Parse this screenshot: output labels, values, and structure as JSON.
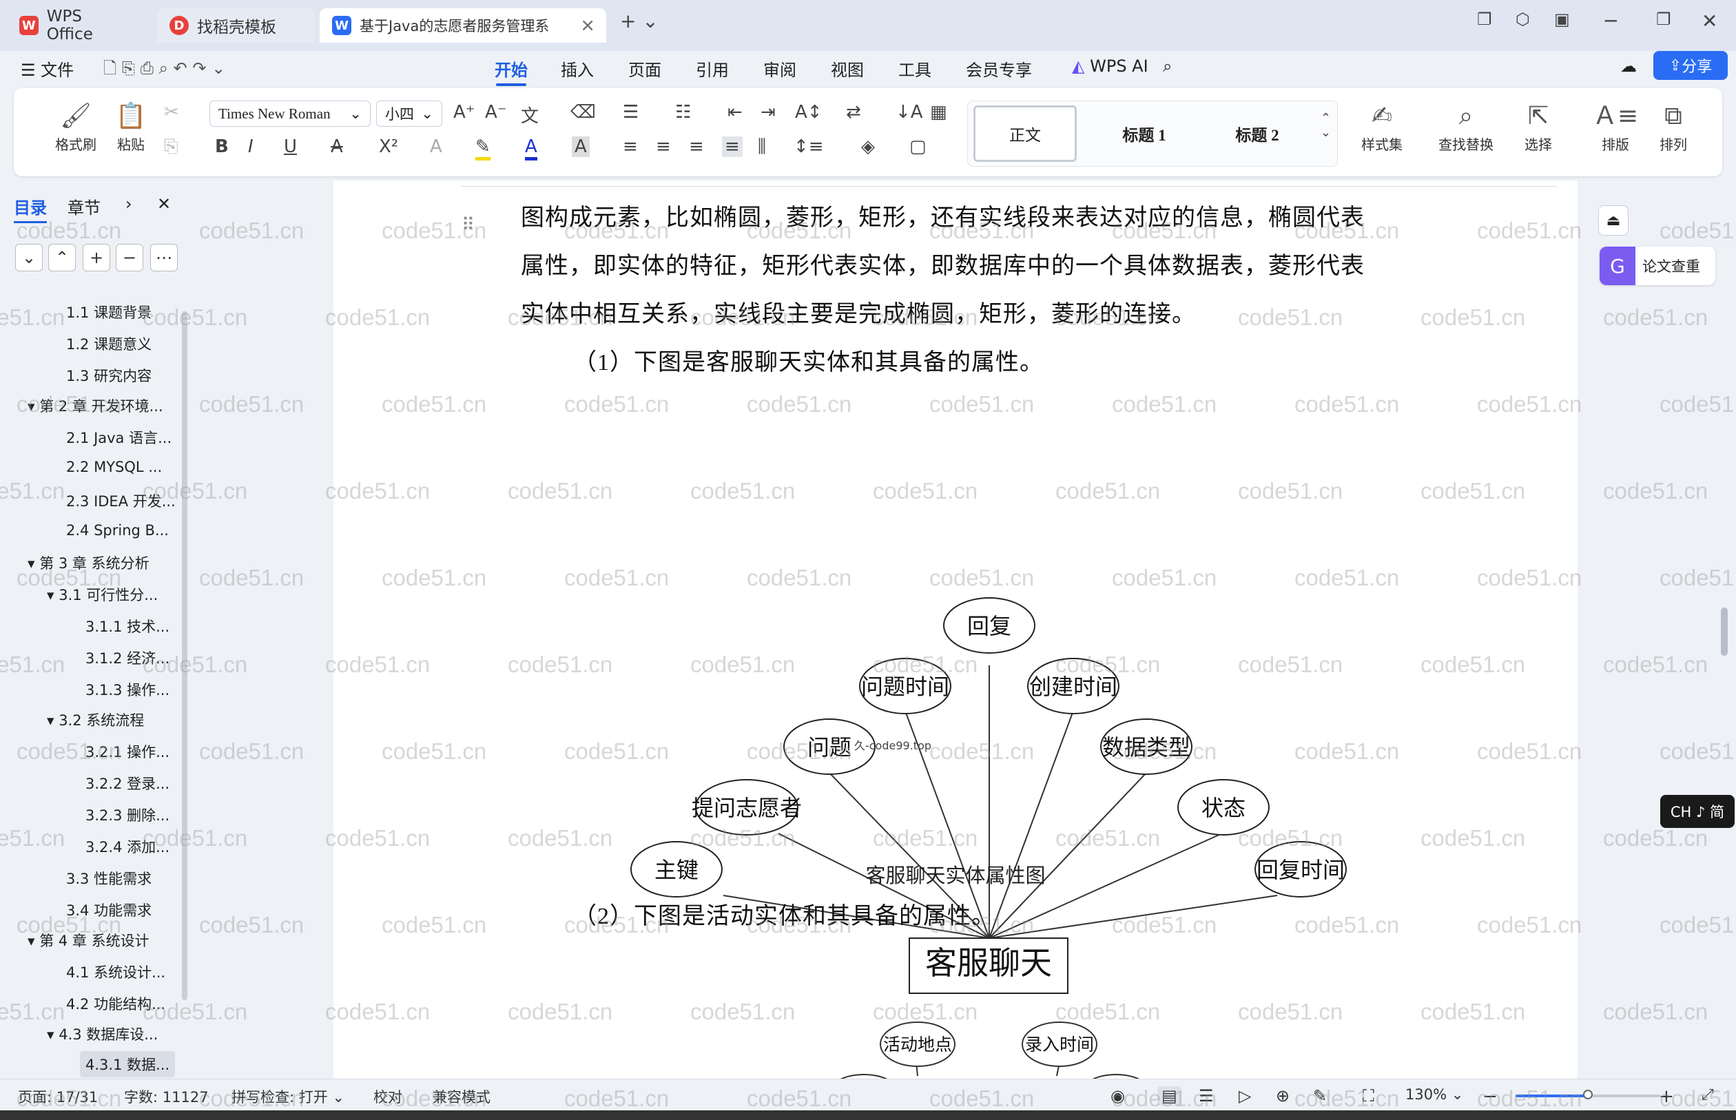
{
  "tabs": [
    {
      "label": "WPS Office"
    },
    {
      "label": "找稻壳模板"
    },
    {
      "label": "基于Java的志愿者服务管理系"
    }
  ],
  "menu": {
    "file": "文件",
    "items": [
      "开始",
      "插入",
      "页面",
      "引用",
      "审阅",
      "视图",
      "工具",
      "会员专享"
    ],
    "ai": "WPS AI",
    "share": "分享"
  },
  "ribbon": {
    "format_painter": "格式刷",
    "paste": "粘贴",
    "font": "Times New Roman",
    "size": "小四",
    "style_normal": "正文",
    "style_h1": "标题 1",
    "style_h2": "标题 2",
    "styleset": "样式集",
    "find": "查找替换",
    "select": "选择",
    "typeset": "排版",
    "arrange": "排列"
  },
  "sidebar": {
    "tab_toc": "目录",
    "tab_chapter": "章节",
    "items": [
      "1.1 课题背景",
      "1.2 课题意义",
      "1.3 研究内容",
      "第 2 章 开发环境...",
      "2.1 Java 语言...",
      "2.2 MYSQL ...",
      "2.3 IDEA 开发...",
      "2.4 Spring B...",
      "第 3 章 系统分析",
      "3.1 可行性分...",
      "3.1.1 技术...",
      "3.1.2 经济...",
      "3.1.3 操作...",
      "3.2 系统流程",
      "3.2.1 操作...",
      "3.2.2 登录...",
      "3.2.3 删除...",
      "3.2.4 添加...",
      "3.3 性能需求",
      "3.4 功能需求",
      "第 4 章 系统设计",
      "4.1 系统设计...",
      "4.2 功能结构...",
      "4.3 数据库设...",
      "4.3.1 数据..."
    ]
  },
  "doc": {
    "p1": "图构成元素，比如椭圆，菱形，矩形，还有实线段来表达对应的信息，椭圆代表",
    "p2": "属性，即实体的特征，矩形代表实体，即数据库中的一个具体数据表，菱形代表",
    "p3": "实体中相互关系，实线段主要是完成椭圆，矩形，菱形的连接。",
    "p4": "（1）下图是客服聊天实体和其具备的属性。",
    "entity": "客服聊天",
    "attrs": [
      "回复",
      "问题时间",
      "创建时间",
      "问题",
      "数据类型",
      "提问志愿者",
      "状态",
      "主键",
      "回复时间"
    ],
    "overlay": "久-code99.top",
    "caption": "客服聊天实体属性图",
    "p5": "（2）下图是活动实体和其具备的属性。",
    "attrs2": [
      "活动地点",
      "录入时间"
    ]
  },
  "right": {
    "plagiarism": "论文查重",
    "ime": "CH ♪ 简"
  },
  "status": {
    "page": "页面: 17/31",
    "words": "字数: 11127",
    "spell": "拼写检查: 打开",
    "proof": "校对",
    "compat": "兼容模式",
    "zoom": "130%",
    "zoom_level": 0.5
  },
  "watermark": "code51.cn"
}
